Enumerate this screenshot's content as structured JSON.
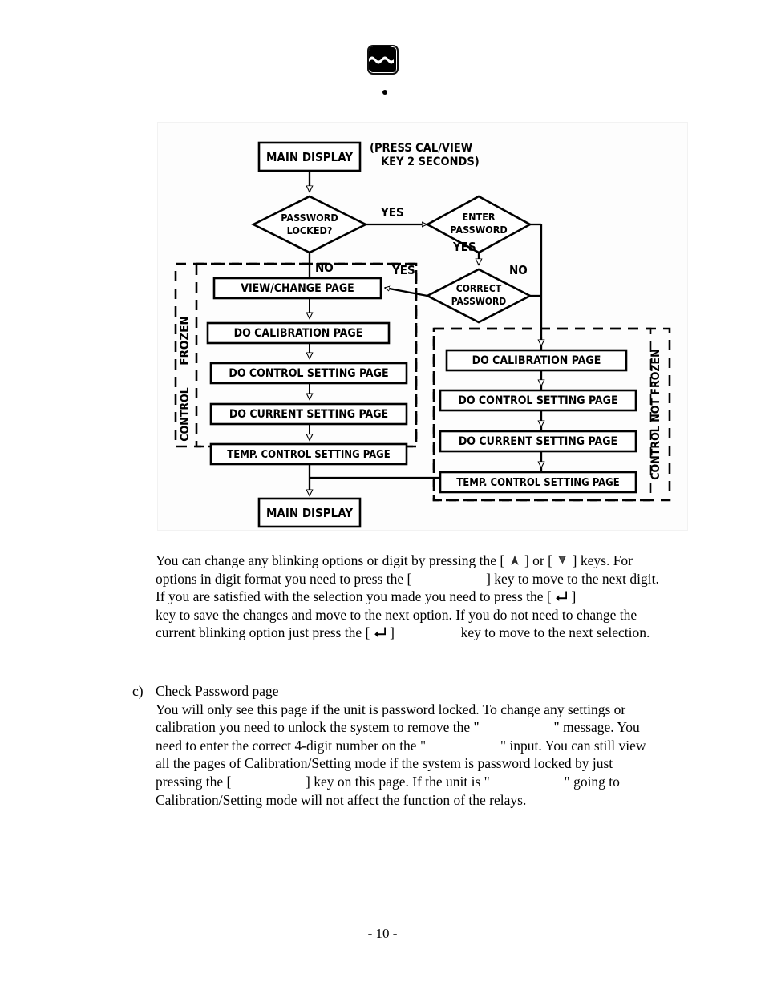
{
  "page": {
    "number_label": "- 10 -",
    "logo_alt": "wave-logo"
  },
  "figure": {
    "title": "Calibration/Setting mode flowchart",
    "nodes": {
      "main_display_top": "MAIN DISPLAY",
      "press_note_line1": "(PRESS CAL/VIEW",
      "press_note_line2": "KEY 2 SECONDS)",
      "password_locked_l1": "PASSWORD",
      "password_locked_l2": "LOCKED?",
      "enter_password_l1": "ENTER",
      "enter_password_l2": "PASSWORD",
      "correct_password_l1": "CORRECT",
      "correct_password_l2": "PASSWORD",
      "view_change_page": "VIEW/CHANGE PAGE",
      "do_calibration_page": "DO CALIBRATION PAGE",
      "do_control_setting_page": "DO CONTROL SETTING PAGE",
      "do_current_setting_page": "DO CURRENT SETTING PAGE",
      "temp_control_setting_page": "TEMP. CONTROL SETTING PAGE",
      "do_calibration_page_right": "DO CALIBRATION PAGE",
      "do_control_setting_page_right": "DO CONTROL SETTING PAGE",
      "do_current_setting_page_right": "DO CURRENT SETTING PAGE",
      "temp_control_setting_page_right": "TEMP. CONTROL SETTING PAGE",
      "main_display_bottom": "MAIN DISPLAY"
    },
    "edge_labels": {
      "yes_password_locked": "YES",
      "no_password_locked": "NO",
      "yes_enter_password": "YES",
      "yes_correct_password": "YES",
      "no_correct_password": "NO"
    },
    "group_labels": {
      "frozen": "FROZEN",
      "control": "CONTROL",
      "control_not_frozen": "CONTROL NOT FROZEN"
    }
  },
  "body": {
    "keys_paragraph": {
      "s1": "You can change any blinking options or digit by pressing the [",
      "s2": "] or [",
      "s3": "] keys. For options in digit format you need to press the [",
      "s4": "] key to move to the next digit. If you are satisfied with the selection you made you need to press the [",
      "s5": "]",
      "s6": "key to save the changes and move to the next option. If you do not need to change the current blinking option just press the [",
      "s7": "]",
      "s8": "key to move to the next selection."
    },
    "item_c": {
      "marker": "c)",
      "title": "Check Password page",
      "t1": "You will only see this page if the unit is password locked. To change any settings or calibration you need to unlock the system to remove the \"",
      "t2": "\" message. You need to enter the correct 4-digit number on the \"",
      "t3": "\" input. You can still view all the pages of Calibration/Setting mode if the system is password locked by just pressing the [",
      "t4": "] key on this page. If the unit is \"",
      "t5": "\" going to Calibration/Setting mode will not affect the function of the relays."
    }
  }
}
